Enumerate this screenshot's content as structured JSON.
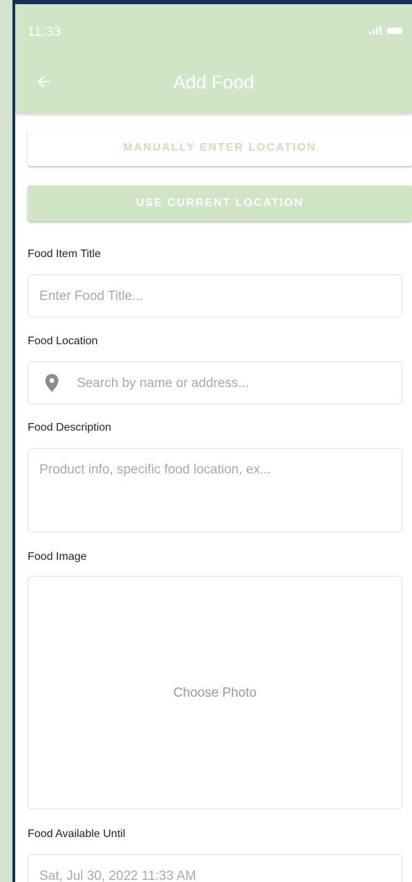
{
  "status_bar": {
    "time": "11:33"
  },
  "app_bar": {
    "title": "Add Food"
  },
  "buttons": {
    "manual_location": "MANUALLY ENTER LOCATION",
    "current_location": "USE CURRENT LOCATION"
  },
  "form": {
    "title": {
      "label": "Food Item Title",
      "placeholder": "Enter Food Title..."
    },
    "location": {
      "label": "Food Location",
      "placeholder": "Search by name or address..."
    },
    "description": {
      "label": "Food Description",
      "placeholder": "Product info, specific food location, ex..."
    },
    "image": {
      "label": "Food Image",
      "button": "Choose Photo"
    },
    "available_until": {
      "label": "Food Available Until",
      "value": "Sat, Jul 30, 2022 11:33 AM"
    }
  },
  "colors": {
    "app_bar": "#cfe5c6",
    "frame": "#163058",
    "page_background": "#d4e3cd",
    "manual_button_text": "#c8e2be"
  },
  "icons": [
    "back-arrow-icon",
    "location-pin-icon",
    "signal-icon",
    "battery-icon"
  ]
}
